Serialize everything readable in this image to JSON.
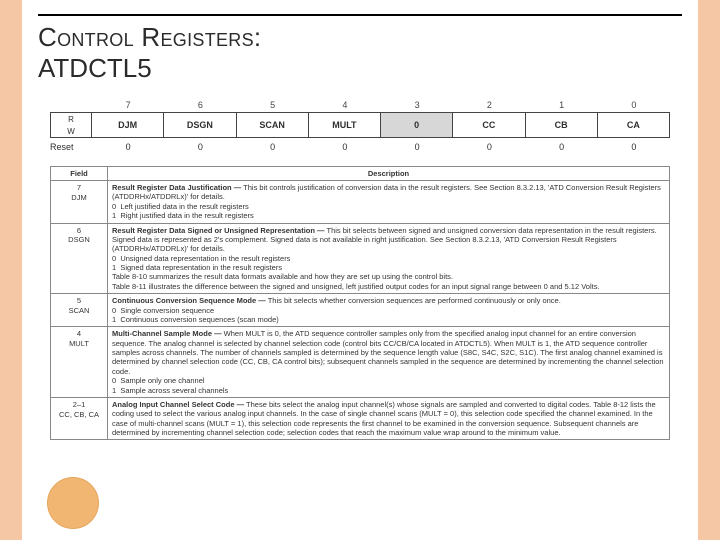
{
  "title_line1": "Control Registers:",
  "title_line2": "ATDCTL5",
  "bit_numbers": [
    "7",
    "6",
    "5",
    "4",
    "3",
    "2",
    "1",
    "0"
  ],
  "rw": {
    "r": "R",
    "w": "W"
  },
  "bits": [
    "DJM",
    "DSGN",
    "SCAN",
    "MULT",
    "0",
    "CC",
    "CB",
    "CA"
  ],
  "reset_label": "Reset",
  "reset_values": [
    "0",
    "0",
    "0",
    "0",
    "0",
    "0",
    "0",
    "0"
  ],
  "headers": {
    "field": "Field",
    "desc": "Description"
  },
  "rows": [
    {
      "field_num": "7",
      "field_name": "DJM",
      "desc": "<span class='b'>Result Register Data Justification —</span> This bit controls justification of conversion data in the result registers. See Section 8.3.2.13, 'ATD Conversion Result Registers (ATDDRHx/ATDDRLx)' for details.<br>0&nbsp;&nbsp;Left justified data in the result registers<br>1&nbsp;&nbsp;Right justified data in the result registers"
    },
    {
      "field_num": "6",
      "field_name": "DSGN",
      "desc": "<span class='b'>Result Register Data Signed or Unsigned Representation —</span> This bit selects between signed and unsigned conversion data representation in the result registers. Signed data is represented as 2's complement. Signed data is not available in right justification. See Section 8.3.2.13, 'ATD Conversion Result Registers (ATDDRHx/ATDDRLx)' for details.<br>0&nbsp;&nbsp;Unsigned data representation in the result registers<br>1&nbsp;&nbsp;Signed data representation in the result registers<br>Table 8-10 summarizes the result data formats available and how they are set up using the control bits.<br>Table 8-11 illustrates the difference between the signed and unsigned, left justified output codes for an input signal range between 0 and 5.12 Volts."
    },
    {
      "field_num": "5",
      "field_name": "SCAN",
      "desc": "<span class='b'>Continuous Conversion Sequence Mode —</span> This bit selects whether conversion sequences are performed continuously or only once.<br>0&nbsp;&nbsp;Single conversion sequence<br>1&nbsp;&nbsp;Continuous conversion sequences (scan mode)"
    },
    {
      "field_num": "4",
      "field_name": "MULT",
      "desc": "<span class='b'>Multi-Channel Sample Mode —</span> When MULT is 0, the ATD sequence controller samples only from the specified analog input channel for an entire conversion sequence. The analog channel is selected by channel selection code (control bits CC/CB/CA located in ATDCTL5). When MULT is 1, the ATD sequence controller samples across channels. The number of channels sampled is determined by the sequence length value (S8C, S4C, S2C, S1C). The first analog channel examined is determined by channel selection code (CC, CB, CA control bits); subsequent channels sampled in the sequence are determined by incrementing the channel selection code.<br>0&nbsp;&nbsp;Sample only one channel<br>1&nbsp;&nbsp;Sample across several channels"
    },
    {
      "field_num": "2–1",
      "field_name": "CC, CB, CA",
      "desc": "<span class='b'>Analog Input Channel Select Code —</span> These bits select the analog input channel(s) whose signals are sampled and converted to digital codes. Table 8-12 lists the coding used to select the various analog input channels. In the case of single channel scans (MULT = 0), this selection code specified the channel examined. In the case of multi-channel scans (MULT = 1), this selection code represents the first channel to be examined in the conversion sequence. Subsequent channels are determined by incrementing channel selection code; selection codes that reach the maximum value wrap around to the minimum value."
    }
  ]
}
